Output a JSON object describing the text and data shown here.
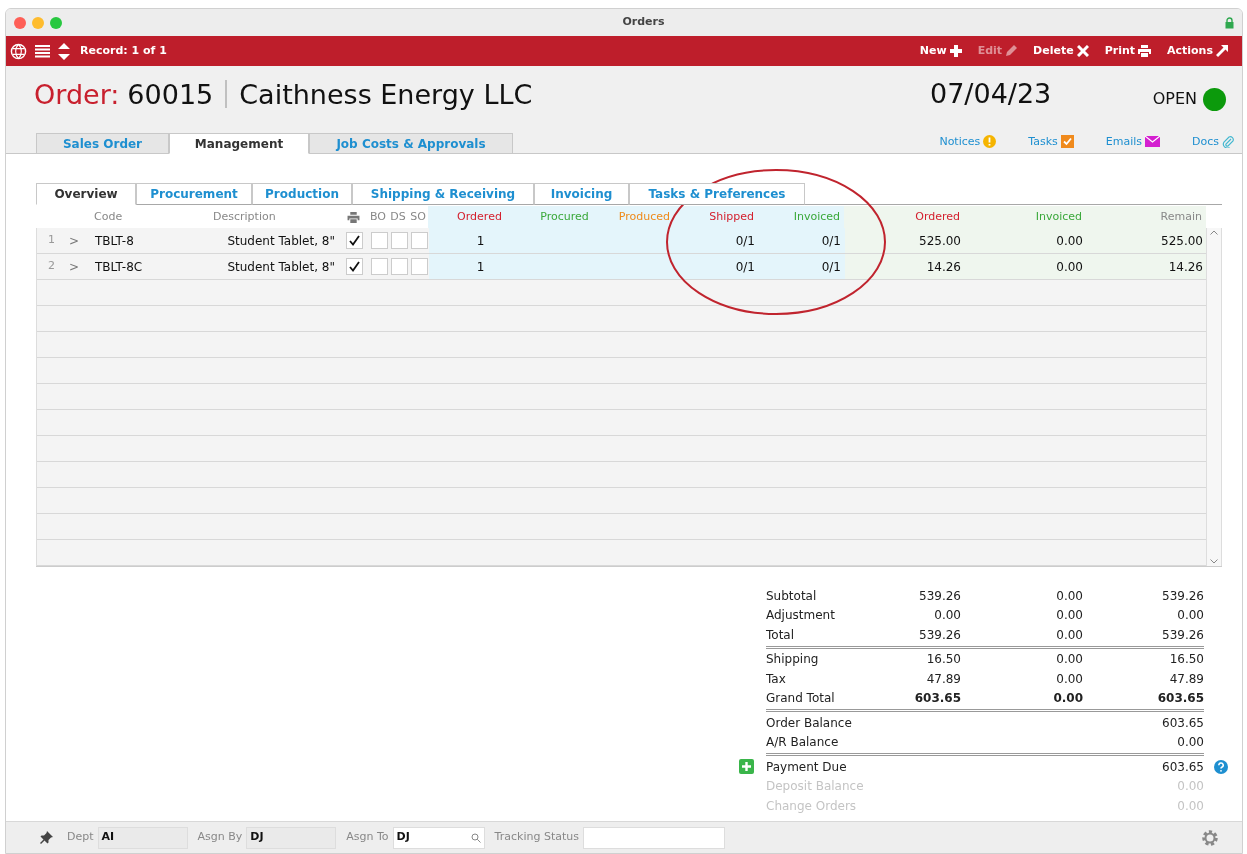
{
  "window": {
    "title": "Orders"
  },
  "toolbar": {
    "record_label": "Record: 1 of 1",
    "actions": [
      {
        "label": "New",
        "kind": "new",
        "disabled": false
      },
      {
        "label": "Edit",
        "kind": "edit",
        "disabled": true
      },
      {
        "label": "Delete",
        "kind": "delete",
        "disabled": false
      },
      {
        "label": "Print",
        "kind": "print",
        "disabled": false
      },
      {
        "label": "Actions",
        "kind": "actions",
        "disabled": false
      }
    ]
  },
  "header": {
    "order_label": "Order:",
    "order_number": "60015",
    "customer": "Caithness Energy LLC",
    "date": "07/04/23",
    "status": "OPEN"
  },
  "main_tabs": [
    {
      "label": "Sales Order",
      "selected": false
    },
    {
      "label": "Management",
      "selected": true
    },
    {
      "label": "Job Costs & Approvals",
      "selected": false
    }
  ],
  "links": [
    {
      "label": "Notices",
      "kind": "notice"
    },
    {
      "label": "Tasks",
      "kind": "task"
    },
    {
      "label": "Emails",
      "kind": "email"
    },
    {
      "label": "Docs",
      "kind": "doc"
    }
  ],
  "sub_tabs": [
    {
      "label": "Overview",
      "selected": true
    },
    {
      "label": "Procurement",
      "selected": false
    },
    {
      "label": "Production",
      "selected": false
    },
    {
      "label": "Shipping & Receiving",
      "selected": false
    },
    {
      "label": "Invoicing",
      "selected": false
    },
    {
      "label": "Tasks & Preferences",
      "selected": false
    }
  ],
  "table": {
    "columns": [
      "Code",
      "Description",
      "BO",
      "DS",
      "SO",
      "Ordered",
      "Procured",
      "Produced",
      "Shipped",
      "Invoiced",
      "Ordered",
      "Invoiced",
      "Remain"
    ],
    "rows": [
      {
        "number": "1",
        "expander": ">",
        "code": "TBLT-8",
        "description": "Student Tablet, 8\"",
        "print": true,
        "bo": false,
        "ds": false,
        "so": false,
        "ordered": "1",
        "shipped": "0/1",
        "invoiced": "0/1",
        "amount_ordered": "525.00",
        "amount_invoiced": "0.00",
        "remain": "525.00"
      },
      {
        "number": "2",
        "expander": ">",
        "code": "TBLT-8C",
        "description": "Student Tablet, 8\"",
        "print": true,
        "bo": false,
        "ds": false,
        "so": false,
        "ordered": "1",
        "shipped": "0/1",
        "invoiced": "0/1",
        "amount_ordered": "14.26",
        "amount_invoiced": "0.00",
        "remain": "14.26"
      }
    ]
  },
  "totals": [
    {
      "label": "Subtotal",
      "values": [
        "539.26",
        "0.00",
        "539.26"
      ],
      "kind": "plain",
      "disabled": false,
      "divider_after": false
    },
    {
      "label": "Adjustment",
      "values": [
        "0.00",
        "0.00",
        "0.00"
      ],
      "kind": "plain",
      "disabled": false,
      "divider_after": false
    },
    {
      "label": "Total",
      "values": [
        "539.26",
        "0.00",
        "539.26"
      ],
      "kind": "plain",
      "disabled": false,
      "divider_after": true
    },
    {
      "label": "Shipping",
      "values": [
        "16.50",
        "0.00",
        "16.50"
      ],
      "kind": "plain",
      "disabled": false,
      "divider_after": false
    },
    {
      "label": "Tax",
      "values": [
        "47.89",
        "0.00",
        "47.89"
      ],
      "kind": "plain",
      "disabled": false,
      "divider_after": false
    },
    {
      "label": "Grand Total",
      "values": [
        "603.65",
        "0.00",
        "603.65"
      ],
      "kind": "bold",
      "disabled": false,
      "divider_after": true
    },
    {
      "label": "Order Balance",
      "values": [
        "603.65"
      ],
      "kind": "plain",
      "disabled": false,
      "divider_after": false
    },
    {
      "label": "A/R Balance",
      "values": [
        "0.00"
      ],
      "kind": "plain",
      "disabled": false,
      "divider_after": true
    },
    {
      "label": "Payment Due",
      "values": [
        "603.65"
      ],
      "kind": "payment",
      "disabled": false,
      "divider_after": false
    },
    {
      "label": "Deposit Balance",
      "values": [
        "0.00"
      ],
      "kind": "plain",
      "disabled": true,
      "divider_after": false
    },
    {
      "label": "Change Orders",
      "values": [
        "0.00"
      ],
      "kind": "plain",
      "disabled": true,
      "divider_after": false
    }
  ],
  "footer": {
    "fields": [
      {
        "label": "Dept",
        "value": "AI",
        "kind": "plain"
      },
      {
        "label": "Asgn By",
        "value": "DJ",
        "kind": "plain"
      },
      {
        "label": "Asgn To",
        "value": "DJ",
        "kind": "search"
      },
      {
        "label": "Tracking Status",
        "kind": "white"
      }
    ]
  }
}
